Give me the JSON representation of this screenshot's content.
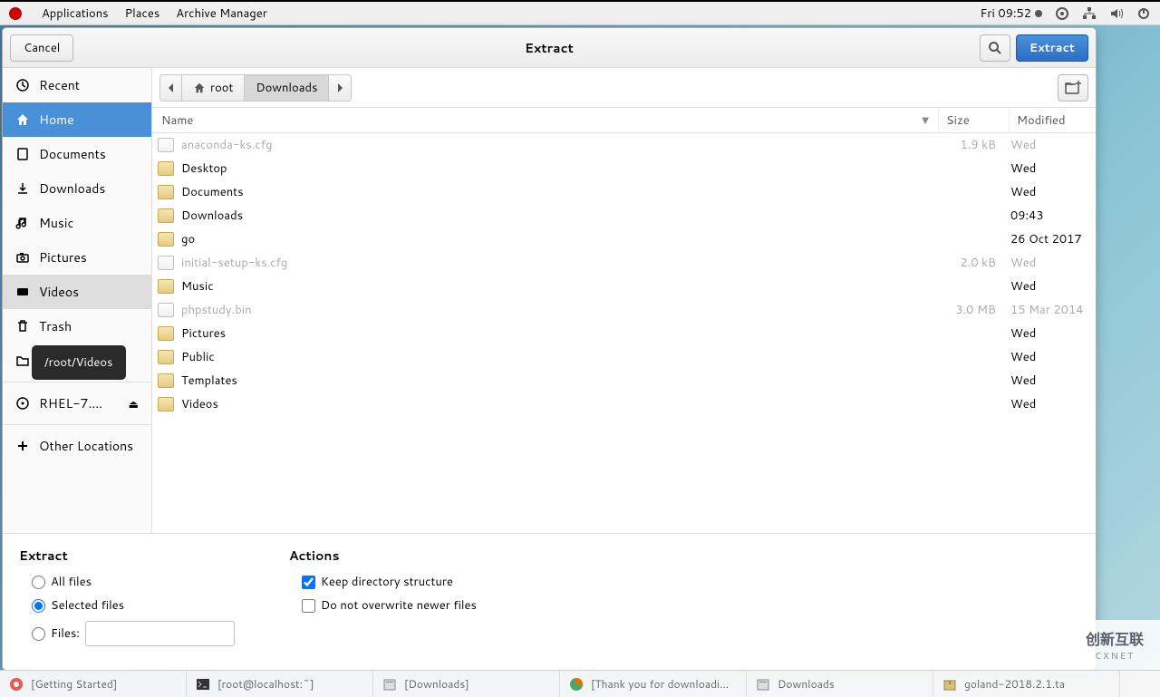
{
  "topbar": {
    "apps": "Applications",
    "places": "Places",
    "app_name": "Archive Manager",
    "time": "Fri 09:52"
  },
  "dialog": {
    "title": "Extract",
    "cancel": "Cancel",
    "extract": "Extract"
  },
  "sidebar": {
    "items": [
      {
        "label": "Recent",
        "icon": "clock"
      },
      {
        "label": "Home",
        "icon": "home",
        "selected": true
      },
      {
        "label": "Documents",
        "icon": "doc"
      },
      {
        "label": "Downloads",
        "icon": "download"
      },
      {
        "label": "Music",
        "icon": "music"
      },
      {
        "label": "Pictures",
        "icon": "camera"
      },
      {
        "label": "Videos",
        "icon": "video",
        "hover": true
      },
      {
        "label": "Trash",
        "icon": "trash"
      },
      {
        "label": "/",
        "icon": "folder"
      }
    ],
    "device": "RHEL-7....",
    "other": "Other Locations"
  },
  "tooltip": "/root/Videos",
  "path": {
    "root": "root",
    "current": "Downloads"
  },
  "columns": {
    "name": "Name",
    "size": "Size",
    "modified": "Modified"
  },
  "files": [
    {
      "name": "anaconda-ks.cfg",
      "type": "file",
      "size": "1.9 kB",
      "mod": "Wed",
      "dim": true
    },
    {
      "name": "Desktop",
      "type": "folder",
      "size": "",
      "mod": "Wed"
    },
    {
      "name": "Documents",
      "type": "folder",
      "size": "",
      "mod": "Wed"
    },
    {
      "name": "Downloads",
      "type": "folder",
      "size": "",
      "mod": "09:43"
    },
    {
      "name": "go",
      "type": "folder",
      "size": "",
      "mod": "26 Oct 2017"
    },
    {
      "name": "initial-setup-ks.cfg",
      "type": "file",
      "size": "2.0 kB",
      "mod": "Wed",
      "dim": true
    },
    {
      "name": "Music",
      "type": "folder",
      "size": "",
      "mod": "Wed"
    },
    {
      "name": "phpstudy.bin",
      "type": "file",
      "size": "3.0 MB",
      "mod": "15 Mar 2014",
      "dim": true
    },
    {
      "name": "Pictures",
      "type": "folder",
      "size": "",
      "mod": "Wed"
    },
    {
      "name": "Public",
      "type": "folder",
      "size": "",
      "mod": "Wed"
    },
    {
      "name": "Templates",
      "type": "folder",
      "size": "",
      "mod": "Wed"
    },
    {
      "name": "Videos",
      "type": "folder",
      "size": "",
      "mod": "Wed"
    }
  ],
  "options": {
    "extract_heading": "Extract",
    "all": "All files",
    "selected": "Selected files",
    "files_label": "Files:",
    "actions_heading": "Actions",
    "keep": "Keep directory structure",
    "noover": "Do not overwrite newer files"
  },
  "taskbar": [
    {
      "label": "[Getting Started]",
      "icon": "help"
    },
    {
      "label": "[root@localhost:~]",
      "icon": "terminal"
    },
    {
      "label": "[Downloads]",
      "icon": "files"
    },
    {
      "label": "[Thank you for downloadi...",
      "icon": "firefox"
    },
    {
      "label": "Downloads",
      "icon": "files"
    },
    {
      "label": "goland-2018.2.1.ta",
      "icon": "archive"
    }
  ],
  "watermark": {
    "big": "创新互联",
    "small": "CXNET"
  }
}
